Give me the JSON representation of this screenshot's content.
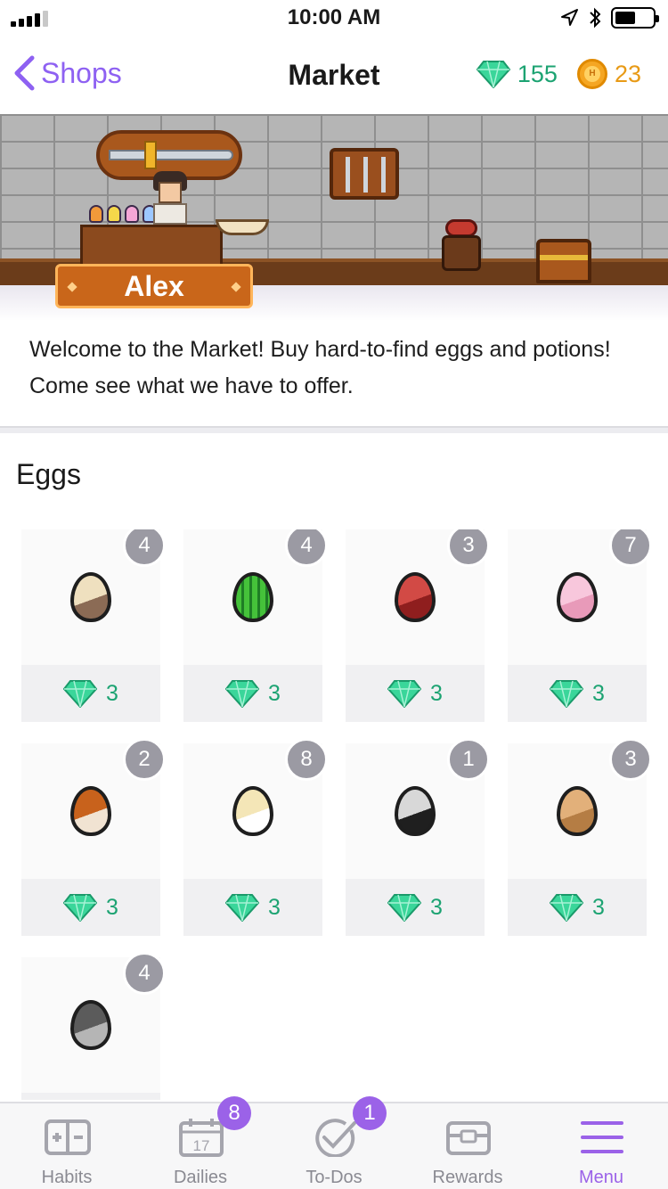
{
  "status_bar": {
    "time": "10:00 AM"
  },
  "nav": {
    "back_label": "Shops",
    "title": "Market",
    "gems": "155",
    "gold": "23",
    "coin_letter": "H"
  },
  "banner": {
    "npc_name": "Alex"
  },
  "welcome_text": "Welcome to the Market! Buy hard-to-find eggs and potions! Come see what we have to offer.",
  "section": {
    "title": "Eggs"
  },
  "eggs": [
    {
      "count": "4",
      "price": "3",
      "color": "#efe0bf",
      "accent": "#8b6b55",
      "icon": "egg-icon"
    },
    {
      "count": "4",
      "price": "3",
      "color": "#45c23a",
      "accent": "#1e7d25",
      "icon": "cactus-egg-icon"
    },
    {
      "count": "3",
      "price": "3",
      "color": "#d24a45",
      "accent": "#8f1e1e",
      "icon": "egg-icon"
    },
    {
      "count": "7",
      "price": "3",
      "color": "#f8c7dc",
      "accent": "#e89ab9",
      "icon": "egg-icon"
    },
    {
      "count": "2",
      "price": "3",
      "color": "#c8621c",
      "accent": "#f1e3d2",
      "icon": "egg-icon"
    },
    {
      "count": "8",
      "price": "3",
      "color": "#f4e6b7",
      "accent": "#ffffff",
      "icon": "egg-icon"
    },
    {
      "count": "1",
      "price": "3",
      "color": "#d8d8d8",
      "accent": "#1f1f1f",
      "icon": "egg-icon"
    },
    {
      "count": "3",
      "price": "3",
      "color": "#e2b07a",
      "accent": "#b57d44",
      "icon": "egg-icon"
    },
    {
      "count": "4",
      "price": "",
      "color": "#5b5b5b",
      "accent": "#b5b5b5",
      "icon": "egg-icon"
    }
  ],
  "tabbar": {
    "tabs": [
      {
        "label": "Habits",
        "icon": "habits-icon",
        "badge": ""
      },
      {
        "label": "Dailies",
        "icon": "calendar-icon",
        "badge": "8",
        "calendar_day": "17"
      },
      {
        "label": "To-Dos",
        "icon": "check-icon",
        "badge": "1"
      },
      {
        "label": "Rewards",
        "icon": "rewards-chest-icon",
        "badge": ""
      },
      {
        "label": "Menu",
        "icon": "menu-icon",
        "badge": ""
      }
    ],
    "active": "Menu"
  },
  "colors": {
    "accent": "#9b62e8",
    "gem": "#1ca372",
    "gold": "#e89a16",
    "badge": "#9b9aa3"
  }
}
